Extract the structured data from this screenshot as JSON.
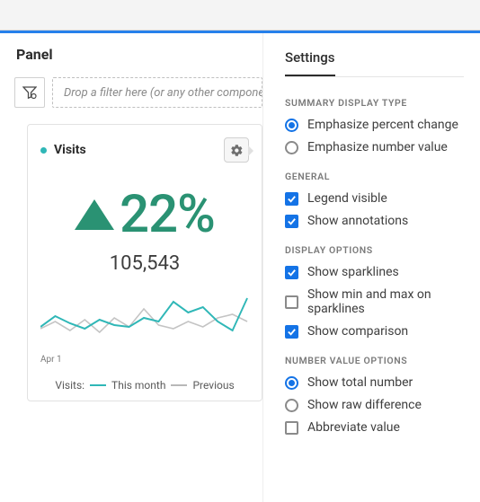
{
  "panel": {
    "title": "Panel"
  },
  "filter": {
    "placeholder": "Drop a filter here (or any other compone"
  },
  "card": {
    "title": "Visits",
    "percent": "22%",
    "number": "105,543",
    "xlabel": "Apr 1",
    "legend_prefix": "Visits:",
    "legend_current": "This month",
    "legend_prev": "Previous"
  },
  "chart_data": {
    "type": "line",
    "categories": [
      "Apr 1",
      "",
      "",
      "",
      "",
      "",
      "",
      "",
      "",
      "",
      "",
      "",
      "",
      "",
      ""
    ],
    "series": [
      {
        "name": "This month",
        "color": "#2fb7b7",
        "values": [
          24,
          38,
          28,
          22,
          34,
          26,
          24,
          36,
          30,
          56,
          40,
          48,
          30,
          18,
          58
        ]
      },
      {
        "name": "Previous",
        "color": "#b8b8b8",
        "values": [
          20,
          30,
          18,
          32,
          16,
          34,
          22,
          46,
          24,
          20,
          30,
          22,
          34,
          38,
          30
        ]
      }
    ],
    "ylim": [
      0,
      60
    ]
  },
  "settings": {
    "tab": "Settings",
    "sections": {
      "summary": {
        "title": "SUMMARY DISPLAY TYPE",
        "opt1": "Emphasize percent change",
        "opt2": "Emphasize number value"
      },
      "general": {
        "title": "GENERAL",
        "opt1": "Legend visible",
        "opt2": "Show annotations"
      },
      "display": {
        "title": "DISPLAY OPTIONS",
        "opt1": "Show sparklines",
        "opt2": "Show min and max on sparklines",
        "opt3": "Show comparison"
      },
      "number": {
        "title": "NUMBER VALUE OPTIONS",
        "opt1": "Show total number",
        "opt2": "Show raw difference",
        "opt3": "Abbreviate value"
      }
    }
  }
}
